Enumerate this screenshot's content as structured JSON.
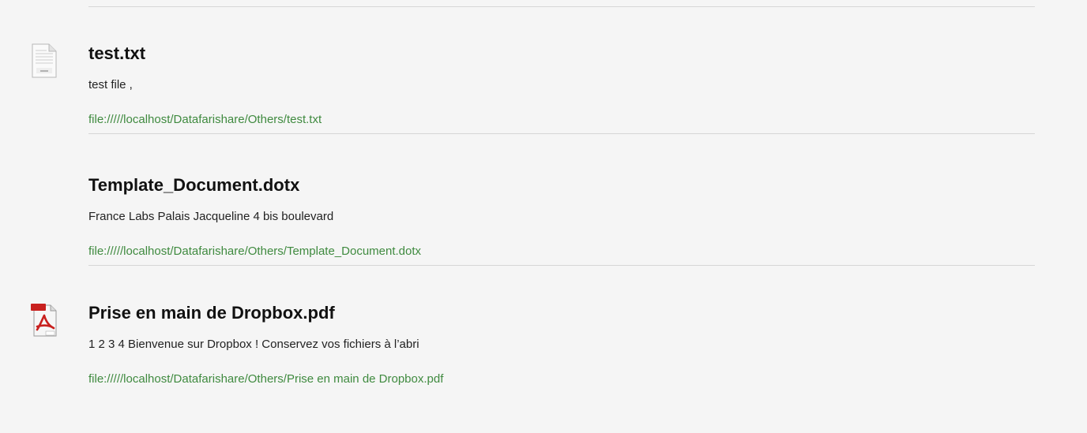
{
  "results": [
    {
      "icon": "text-file-icon",
      "title": "test.txt",
      "snippet": "test file ,",
      "url": "file://///localhost/Datafarishare/Others/test.txt"
    },
    {
      "icon": "",
      "title": "Template_Document.dotx",
      "snippet": "France Labs Palais Jacqueline 4 bis boulevard",
      "url": "file://///localhost/Datafarishare/Others/Template_Document.dotx"
    },
    {
      "icon": "pdf-file-icon",
      "title": "Prise en main de Dropbox.pdf",
      "snippet": "1 2 3 4 Bienvenue sur Dropbox ! Conservez vos fichiers à l’abri",
      "url": "file://///localhost/Datafarishare/Others/Prise en main de Dropbox.pdf"
    }
  ],
  "colors": {
    "url_green": "#3f8a3f",
    "pdf_red": "#c8201e",
    "divider": "#d6d6d6"
  }
}
